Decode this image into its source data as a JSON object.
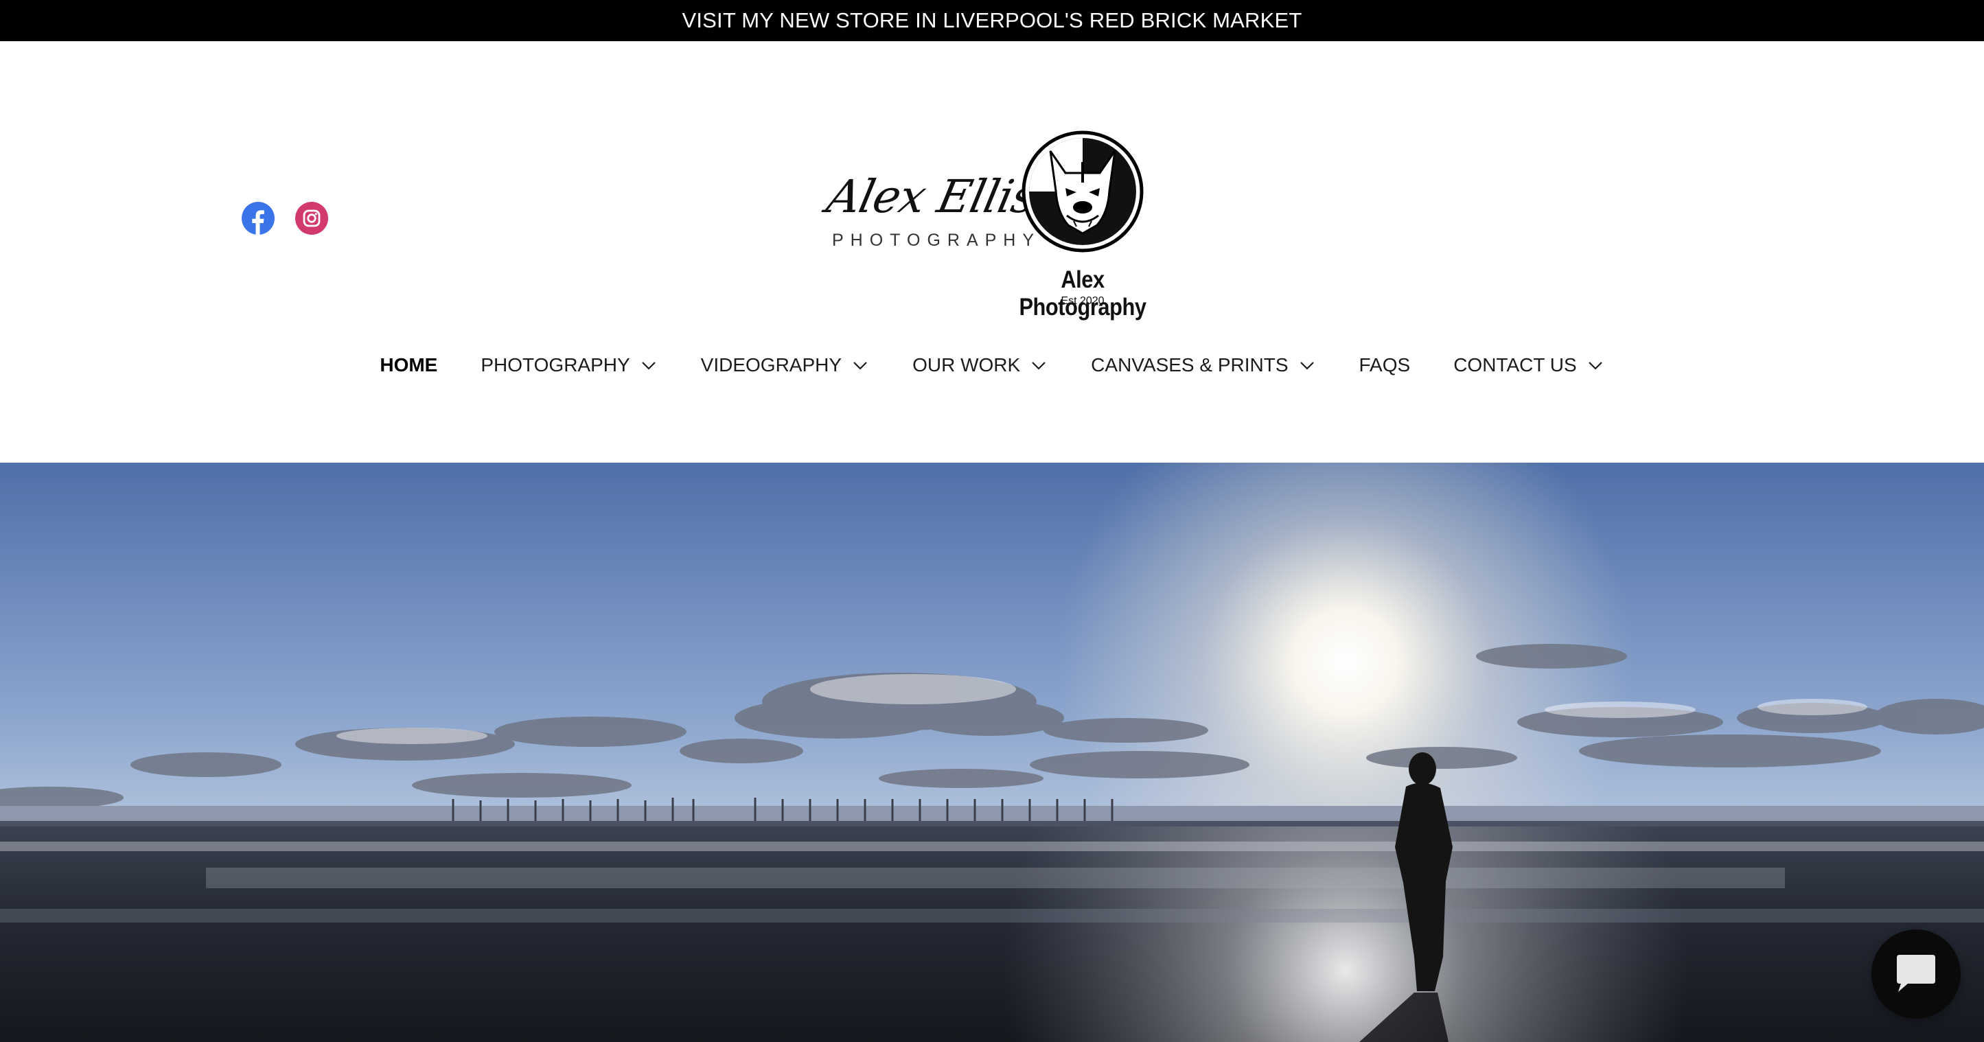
{
  "announcement": {
    "text": "VISIT MY NEW STORE IN LIVERPOOL'S RED BRICK MARKET"
  },
  "social": [
    {
      "icon": "facebook-icon",
      "color": "#3b73e8"
    },
    {
      "icon": "instagram-icon",
      "color": "#d23a6f"
    }
  ],
  "logo": {
    "script_name": "Alex Ellison",
    "script_subtitle": "PHOTOGRAPHY",
    "brand": "Alex Photography",
    "tagline": "Est 2020"
  },
  "nav": {
    "items": [
      {
        "label": "HOME",
        "active": true,
        "has_dropdown": false
      },
      {
        "label": "PHOTOGRAPHY",
        "active": false,
        "has_dropdown": true
      },
      {
        "label": "VIDEOGRAPHY",
        "active": false,
        "has_dropdown": true
      },
      {
        "label": "OUR WORK",
        "active": false,
        "has_dropdown": true
      },
      {
        "label": "CANVASES & PRINTS",
        "active": false,
        "has_dropdown": true
      },
      {
        "label": "FAQS",
        "active": false,
        "has_dropdown": false
      },
      {
        "label": "CONTACT US",
        "active": false,
        "has_dropdown": true
      }
    ]
  },
  "hero": {
    "subject": "beach-sunset-silhouette"
  },
  "chat": {
    "icon": "chat-bubble-icon"
  }
}
